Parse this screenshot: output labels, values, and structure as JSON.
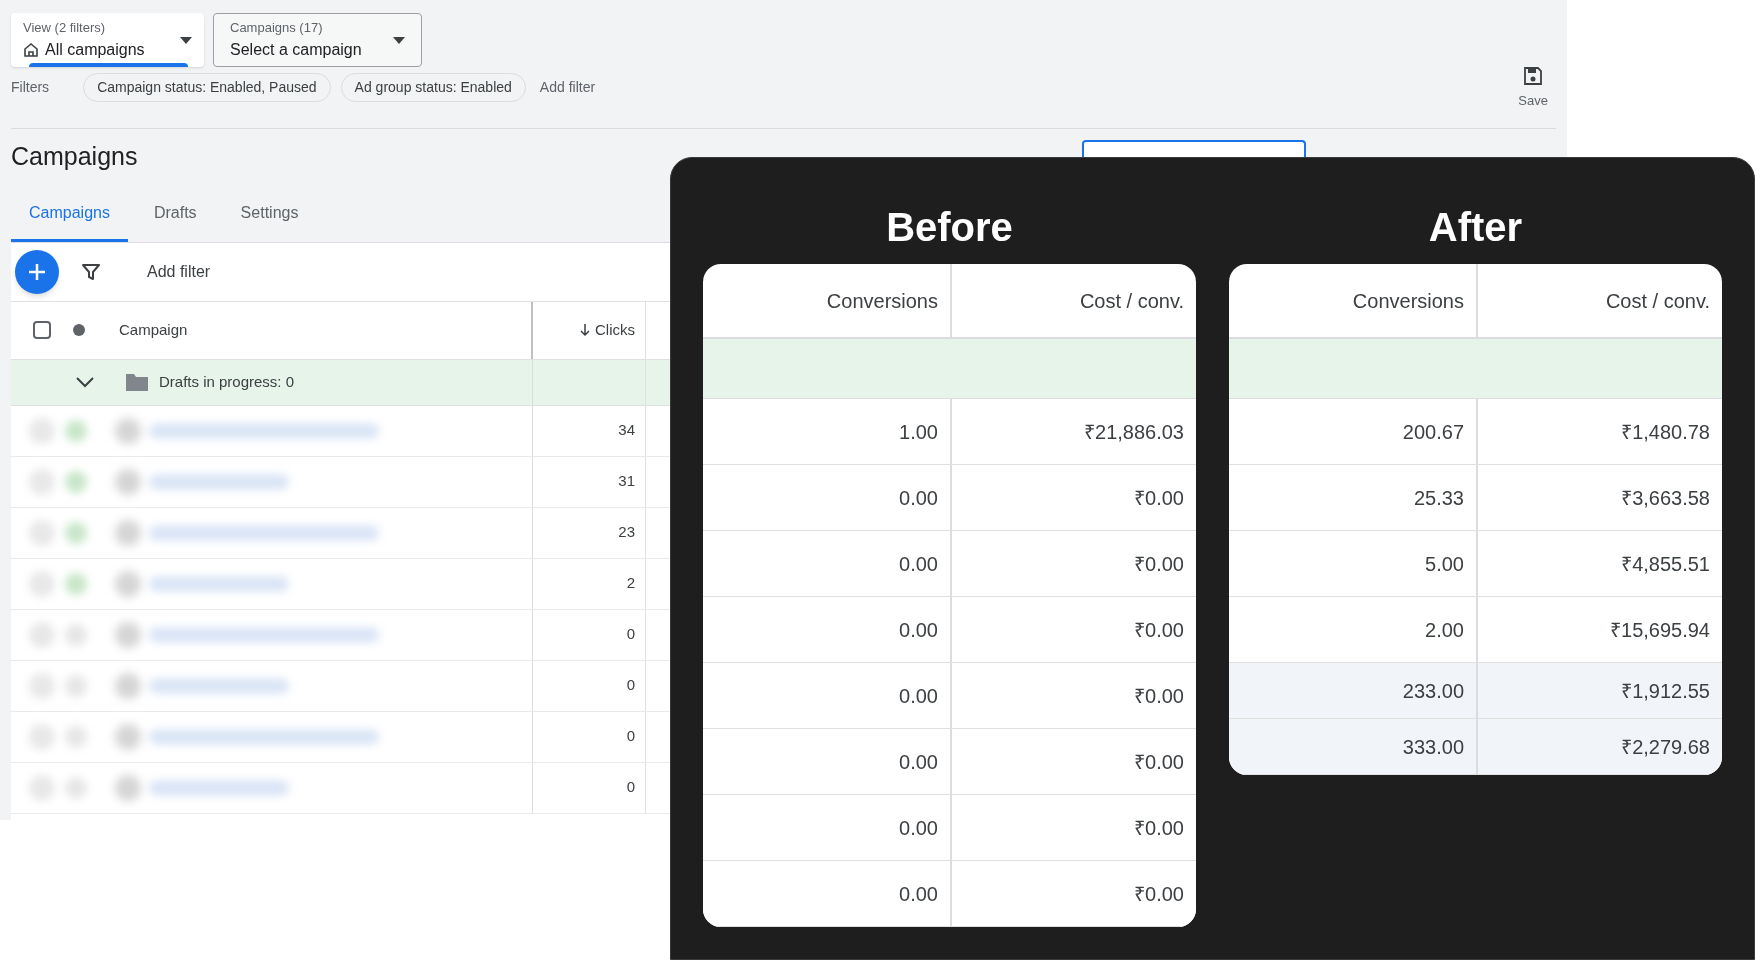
{
  "header": {
    "view_selector": {
      "label": "View (2 filters)",
      "value": "All campaigns"
    },
    "campaign_selector": {
      "label": "Campaigns (17)",
      "value": "Select a campaign"
    },
    "filters": {
      "label": "Filters",
      "chips": [
        "Campaign status: Enabled, Paused",
        "Ad group status: Enabled"
      ],
      "add_filter": "Add filter"
    },
    "save": {
      "label": "Save"
    }
  },
  "page_title": "Campaigns",
  "tabs": [
    {
      "label": "Campaigns",
      "selected": true
    },
    {
      "label": "Drafts",
      "selected": false
    },
    {
      "label": "Settings",
      "selected": false
    }
  ],
  "toolbar": {
    "add_filter": "Add filter"
  },
  "table": {
    "select_all_checked": false,
    "columns": [
      "Campaign",
      "Clicks"
    ],
    "group_row": {
      "label": "Drafts in progress: 0",
      "expanded": true
    },
    "rows": [
      {
        "clicks": "34",
        "enabled": true,
        "checked": false
      },
      {
        "clicks": "31",
        "enabled": true,
        "checked": false
      },
      {
        "clicks": "23",
        "enabled": true,
        "checked": false
      },
      {
        "clicks": "2",
        "enabled": true,
        "checked": false
      },
      {
        "clicks": "0",
        "enabled": false,
        "checked": false
      },
      {
        "clicks": "0",
        "enabled": false,
        "checked": false
      },
      {
        "clicks": "0",
        "enabled": false,
        "checked": false
      },
      {
        "clicks": "0",
        "enabled": false,
        "checked": false
      }
    ]
  },
  "comparison": [
    {
      "title": "Before",
      "columns": [
        "Conversions",
        "Cost / conv."
      ],
      "rows": [
        {
          "cells": [
            "1.00",
            "₹21,886.03"
          ],
          "shaded": false
        },
        {
          "cells": [
            "0.00",
            "₹0.00"
          ],
          "shaded": false
        },
        {
          "cells": [
            "0.00",
            "₹0.00"
          ],
          "shaded": false
        },
        {
          "cells": [
            "0.00",
            "₹0.00"
          ],
          "shaded": false
        },
        {
          "cells": [
            "0.00",
            "₹0.00"
          ],
          "shaded": false
        },
        {
          "cells": [
            "0.00",
            "₹0.00"
          ],
          "shaded": false
        },
        {
          "cells": [
            "0.00",
            "₹0.00"
          ],
          "shaded": false
        },
        {
          "cells": [
            "0.00",
            "₹0.00"
          ],
          "shaded": false
        }
      ]
    },
    {
      "title": "After",
      "columns": [
        "Conversions",
        "Cost / conv."
      ],
      "rows": [
        {
          "cells": [
            "200.67",
            "₹1,480.78"
          ],
          "shaded": false
        },
        {
          "cells": [
            "25.33",
            "₹3,663.58"
          ],
          "shaded": false
        },
        {
          "cells": [
            "5.00",
            "₹4,855.51"
          ],
          "shaded": false
        },
        {
          "cells": [
            "2.00",
            "₹15,695.94"
          ],
          "shaded": false
        },
        {
          "cells": [
            "233.00",
            "₹1,912.55"
          ],
          "shaded": true
        },
        {
          "cells": [
            "333.00",
            "₹2,279.68"
          ],
          "shaded": true
        }
      ]
    }
  ]
}
